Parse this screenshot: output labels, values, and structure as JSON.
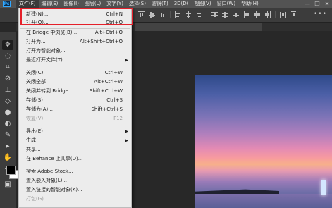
{
  "app": {
    "logo_text": "Ps"
  },
  "menubar": {
    "items": [
      "文件(F)",
      "编辑(E)",
      "图像(I)",
      "图层(L)",
      "文字(Y)",
      "选择(S)",
      "滤镜(T)",
      "3D(D)",
      "视图(V)",
      "窗口(W)",
      "帮助(H)"
    ],
    "window_controls": [
      "—",
      "❐",
      "✕"
    ]
  },
  "file_menu": {
    "items": [
      {
        "label": "新建(N)...",
        "shortcut": "Ctrl+N"
      },
      {
        "label": "打开(O)...",
        "shortcut": "Ctrl+O"
      },
      {
        "label": "在 Bridge 中浏览(B)...",
        "shortcut": "Alt+Ctrl+O"
      },
      {
        "label": "打开为...",
        "shortcut": "Alt+Shift+Ctrl+O"
      },
      {
        "label": "打开为智能对象...",
        "shortcut": ""
      },
      {
        "label": "最近打开文件(T)",
        "shortcut": "",
        "submenu": true
      },
      {
        "label": "关闭(C)",
        "shortcut": "Ctrl+W"
      },
      {
        "label": "关闭全部",
        "shortcut": "Alt+Ctrl+W"
      },
      {
        "label": "关闭并转到 Bridge...",
        "shortcut": "Shift+Ctrl+W"
      },
      {
        "label": "存储(S)",
        "shortcut": "Ctrl+S"
      },
      {
        "label": "存储为(A)...",
        "shortcut": "Shift+Ctrl+S"
      },
      {
        "label": "恢复(V)",
        "shortcut": "F12",
        "disabled": true
      },
      {
        "label": "导出(E)",
        "shortcut": "",
        "submenu": true
      },
      {
        "label": "生成",
        "shortcut": "",
        "submenu": true
      },
      {
        "label": "共享...",
        "shortcut": ""
      },
      {
        "label": "在 Behance 上共享(D)...",
        "shortcut": ""
      },
      {
        "label": "搜索 Adobe Stock...",
        "shortcut": ""
      },
      {
        "label": "置入嵌入对象(L)...",
        "shortcut": ""
      },
      {
        "label": "置入链接的智能对象(K)...",
        "shortcut": ""
      },
      {
        "label": "打包(G)...",
        "shortcut": "",
        "disabled": true
      }
    ]
  },
  "toolbar": {
    "tools": [
      "move-tool",
      "lasso-tool",
      "crop-tool",
      "eyedropper-tool",
      "brush-tool",
      "stamp-tool",
      "eraser-tool",
      "blur-tool",
      "dodge-tool",
      "pen-tool",
      "type-tool",
      "path-select-tool",
      "hand-tool",
      "more-tools"
    ]
  },
  "colors": {
    "highlight_box": "#e5202a",
    "menubar_bg": "#535353",
    "menu_bg": "#ececec"
  }
}
